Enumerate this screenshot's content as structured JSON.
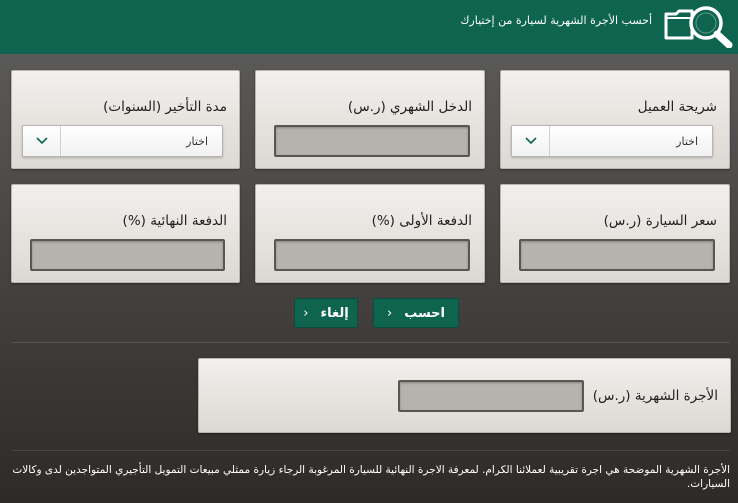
{
  "header": {
    "title": "أحسب الأجرة الشهرية لسيارة من إختيارك",
    "icon": "search-folder-icon"
  },
  "fields": {
    "customer_segment": {
      "label": "شريحة العميل",
      "value": "اختار"
    },
    "monthly_income": {
      "label": "الدخل الشهري (ر.س)",
      "value": ""
    },
    "lease_term": {
      "label": "مدة التأخير (السنوات)",
      "value": "اختار"
    },
    "car_price": {
      "label": "سعر السيارة (ر.س)",
      "value": ""
    },
    "down_payment": {
      "label": "الدفعة الأولى (%)",
      "value": ""
    },
    "final_payment": {
      "label": "الدفعة النهائية (%)",
      "value": ""
    }
  },
  "buttons": {
    "calculate": "احسب",
    "cancel": "إلغاء"
  },
  "result": {
    "label": "الأجرة الشهرية (ر.س)",
    "value": ""
  },
  "disclaimer": "الأجرة الشهرية الموضحة هي اجرة تقريبية لعملائنا الكرام. لمعرفة الاجرة النهائية للسيارة المرغوبة الرجاء زيارة ممثلي مبيعات التمويل التأجيري المتواجدين لدى وكالات السيارات.",
  "colors": {
    "brand_green": "#0f6450",
    "background": "#4a4744",
    "card": "#e8e5e1",
    "input": "#b6b2ad"
  }
}
